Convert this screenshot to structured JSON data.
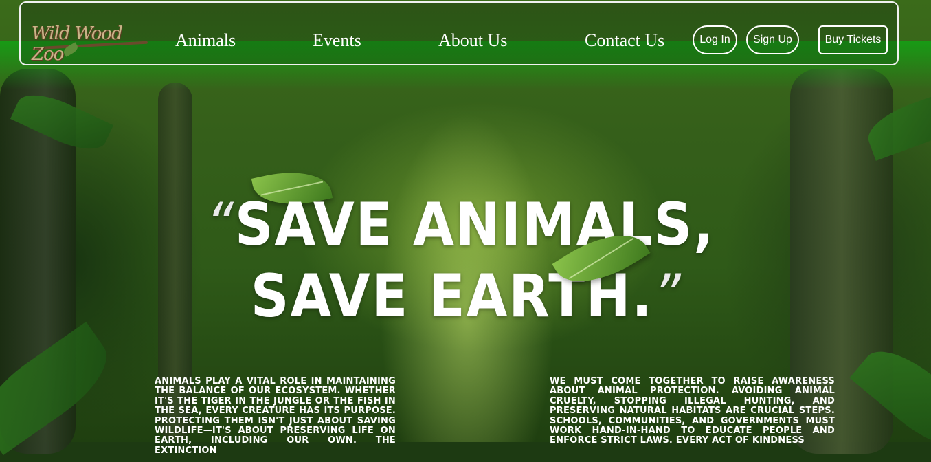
{
  "brand": {
    "logo_text": "Wild Wood Zoo"
  },
  "nav": {
    "links": [
      "Animals",
      "Events",
      "About Us",
      "Contact Us"
    ],
    "login_label": "Log In",
    "signup_label": "Sign Up",
    "tickets_label": "Buy Tickets"
  },
  "hero": {
    "open_quote": "“",
    "line1": "SAVE ANIMALS,",
    "line2": "SAVE EARTH.",
    "close_quote": "”"
  },
  "paragraphs": {
    "left": "Animals play a vital role in maintaining the balance of our ecosystem. Whether it's the tiger in the jungle or the fish in the sea, every creature has its purpose. Protecting them isn't just about saving wildlife—it's about preserving life on Earth, including our own. The extinction",
    "right": "We must come together to raise awareness about animal protection. Avoiding animal cruelty, stopping illegal hunting, and preserving natural habitats are crucial steps. Schools, communities, and governments must work hand-in-hand to educate people and enforce strict laws. Every act of kindness"
  },
  "colors": {
    "nav_glow": "#14a014",
    "text": "#ffffff",
    "border": "#f1f1f1"
  }
}
